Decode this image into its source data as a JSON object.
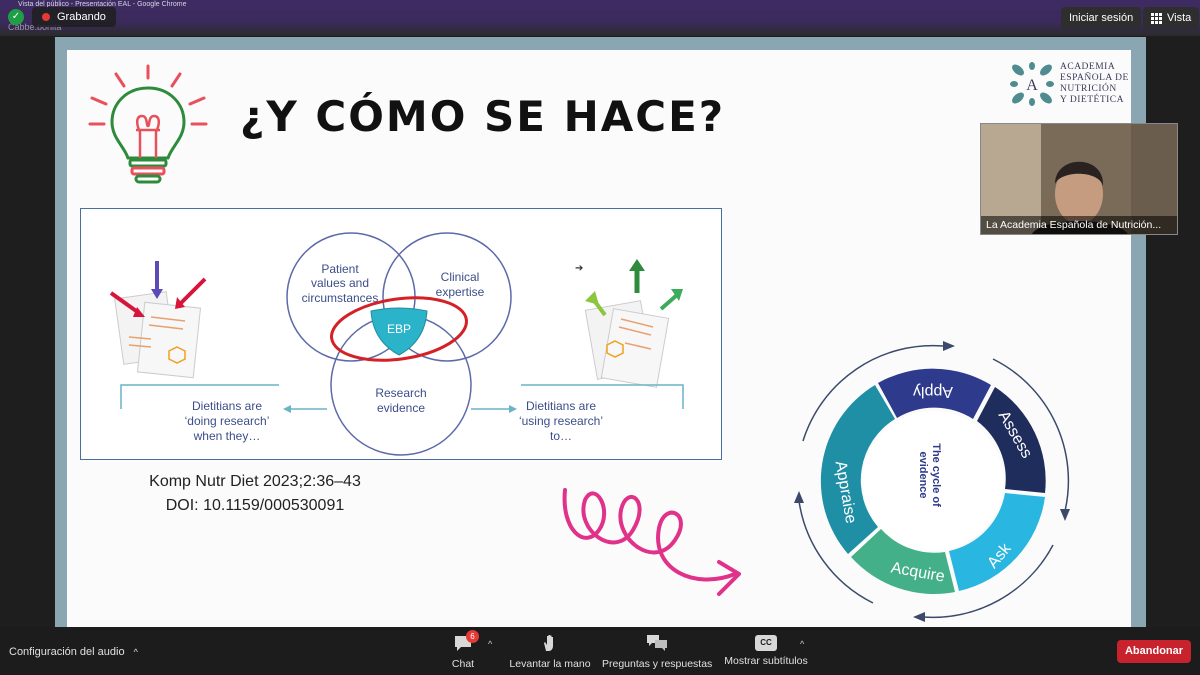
{
  "window": {
    "chrome_title": "Vista del público - Presentación EAL - Google Chrome",
    "recording_label": "Grabando",
    "hint_text": "Cabbe.bonita"
  },
  "top_actions": {
    "signin_label": "Iniciar sesión",
    "view_label": "Vista"
  },
  "slide": {
    "title": "¿Y CÓMO SE HACE?",
    "logo_lines": [
      "ACADEMIA",
      "ESPAÑOLA DE",
      "NUTRICIÓN",
      "Y DIETÉTICA"
    ],
    "logo_letter": "A",
    "figure": {
      "circle_patient": [
        "Patient",
        "values and",
        "circumstances"
      ],
      "circle_clinical": [
        "Clinical",
        "expertise"
      ],
      "center_label": "EBP",
      "circle_research": [
        "Research",
        "evidence"
      ],
      "left_text": [
        "Dietitians are",
        "‘doing research’",
        "when they…"
      ],
      "right_text": [
        "Dietitians are",
        "‘using research’",
        "to…"
      ]
    },
    "citation_line1": "Komp Nutr Diet 2023;2:36–43",
    "citation_line2": "DOI: 10.1159/000530091",
    "cycle": {
      "center_line1": "The cycle of",
      "center_line2": "evidence",
      "segments": [
        "Apply",
        "Assess",
        "Ask",
        "Acquire",
        "Appraise"
      ]
    }
  },
  "video": {
    "participant_name": "La Academia Española de Nutrición..."
  },
  "toolbar": {
    "audio_settings": "Configuración del audio",
    "chat_label": "Chat",
    "chat_badge": "6",
    "raise_hand": "Levantar la mano",
    "qa_label": "Preguntas y respuestas",
    "captions_label": "Mostrar subtítulos",
    "captions_icon_text": "CC",
    "leave_label": "Abandonar"
  },
  "colors": {
    "accent_purple": "#3d2b62",
    "leave_red": "#c8232c",
    "ebp_teal": "#2bb3c9",
    "cycle_dark_blue": "#2e3a8c",
    "cycle_navy": "#1f2d5c",
    "cycle_cyan": "#29b6e0",
    "cycle_green": "#44b08a",
    "cycle_teal": "#1f8fa5",
    "highlight_red": "#d42027",
    "pink_scribble": "#e0328a"
  },
  "icons": [
    "shield-check-icon",
    "record-dot-icon",
    "grid-view-icon",
    "lightbulb-icon",
    "chat-icon",
    "raise-hand-icon",
    "qa-icon",
    "closed-captions-icon",
    "chevron-up-icon"
  ]
}
